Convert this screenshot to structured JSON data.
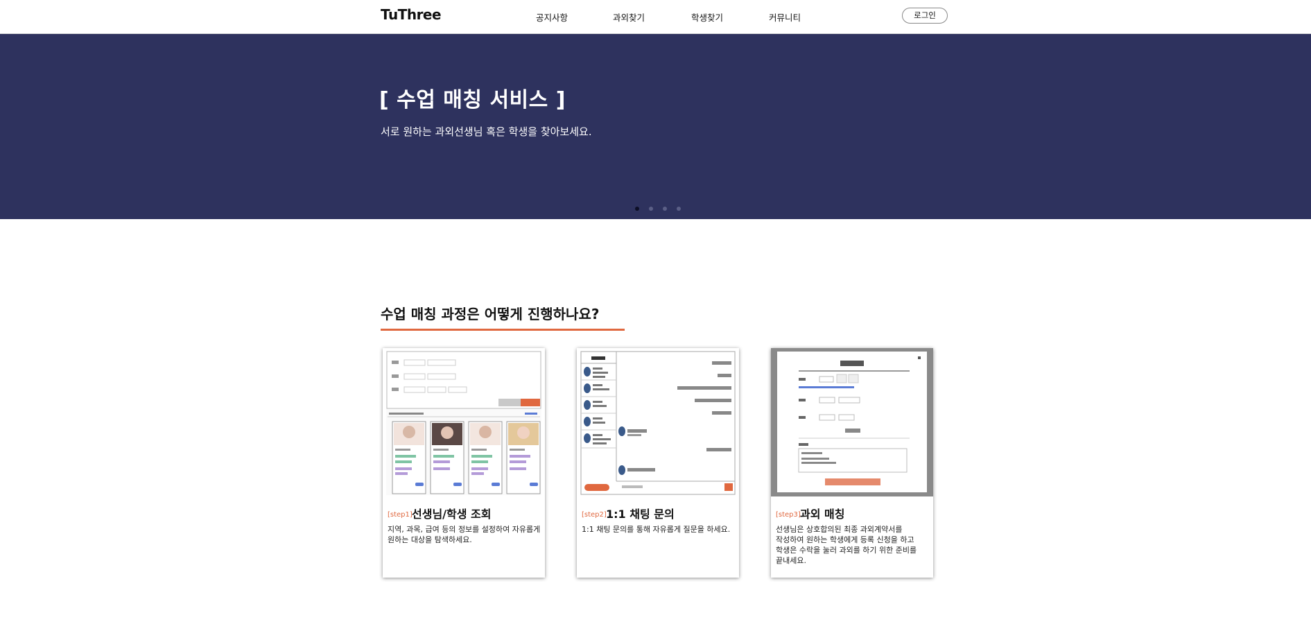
{
  "header": {
    "logo": "TuThree",
    "nav": [
      "공지사항",
      "과외찾기",
      "학생찾기",
      "커뮤니티"
    ],
    "login_label": "로그인"
  },
  "hero": {
    "title": "[ 수업 매칭 서비스 ]",
    "subtitle": "서로 원하는 과외선생님 혹은 학생을 찾아보세요.",
    "background": "#2e325e",
    "slides_count": 4,
    "active_slide": 1
  },
  "section": {
    "title": "수업 매칭 과정은 어떻게 진행하나요?",
    "accent": "#e0683f"
  },
  "steps": [
    {
      "step": "[step1]",
      "title": "선생님/학생 조회",
      "description": "지역, 과목, 급여 등의 정보를 설정하여 자유롭게 원하는 대상을 탐색하세요."
    },
    {
      "step": "[step2]",
      "title": "1:1 채팅 문의",
      "description": "1:1 채팅 문의를 통해 자유롭게 질문을 하세요."
    },
    {
      "step": "[step3]",
      "title": "과외 매칭",
      "description": "선생님은 상호합의된 최종 과외계약서를 작성하여 원하는 학생에게 등록 신청을 하고 학생은 수락을 눌러 과외를 하기 위한 준비를 끝내세요."
    }
  ]
}
